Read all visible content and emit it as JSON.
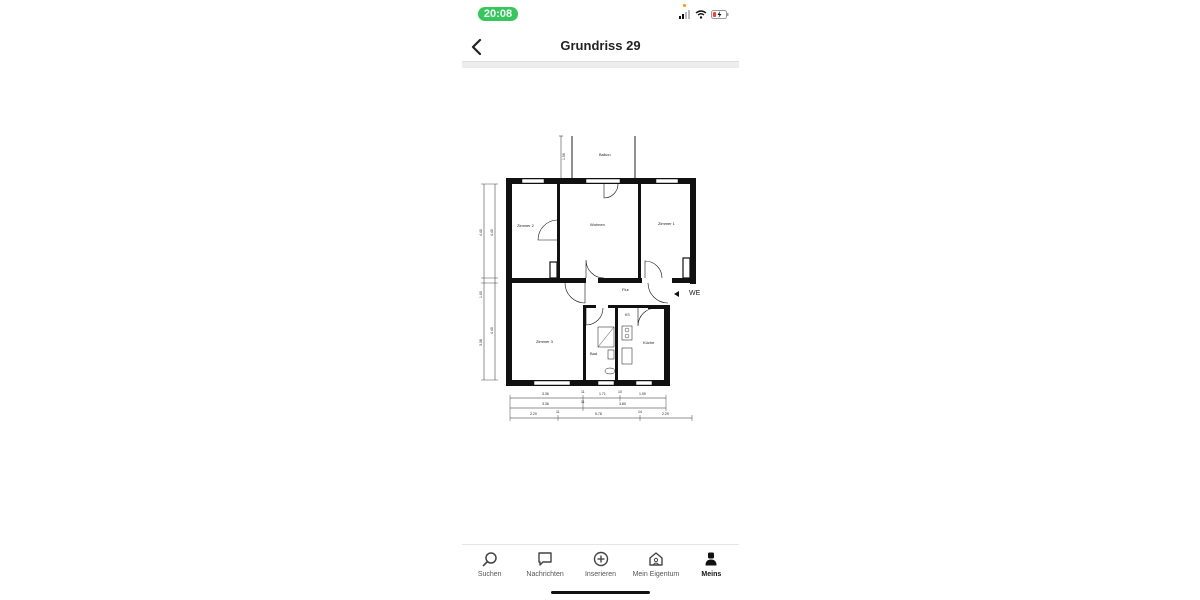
{
  "status_bar": {
    "time": "20:08",
    "icons": [
      "cellular-signal-icon",
      "wifi-icon",
      "battery-charging-icon"
    ],
    "time_color": "#34c759"
  },
  "nav": {
    "back_icon": "chevron-left-icon",
    "title": "Grundriss 29"
  },
  "floorplan": {
    "rooms": {
      "balkon": "Balkon",
      "wohnen": "Wohnen",
      "zimmer1": "Zimmer 1",
      "zimmer2": "Zimmer 2",
      "zimmer3": "Zimmer 3",
      "flur": "Flur",
      "ks": "KS",
      "kuche": "Küche",
      "bad": "Bad",
      "we": "WE"
    },
    "dims": {
      "balkon_h": "1.56",
      "left_1": "4.40",
      "left_2": "4.40",
      "left_3": "1.00",
      "left_4": "4.40",
      "left_5": "3.38",
      "row1": [
        "3.36",
        "11",
        "1.71",
        "10",
        "1.99"
      ],
      "row2": [
        "3.36",
        "11",
        "3.80"
      ],
      "row3": [
        "2.20",
        "11",
        "5.78",
        "14",
        "2.29"
      ]
    }
  },
  "tabbar": {
    "items": [
      {
        "label": "Suchen",
        "icon": "search-icon"
      },
      {
        "label": "Nachrichten",
        "icon": "chat-icon"
      },
      {
        "label": "Inserieren",
        "icon": "plus-circle-icon"
      },
      {
        "label": "Mein Eigentum",
        "icon": "house-icon"
      },
      {
        "label": "Meins",
        "icon": "person-icon"
      }
    ],
    "active_index": 4
  }
}
